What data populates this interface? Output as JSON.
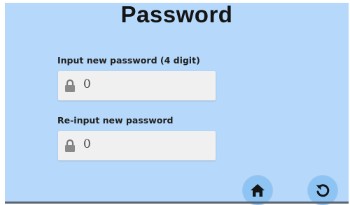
{
  "page": {
    "title": "Password"
  },
  "new_password": {
    "label": "Input new password  (4 digit)",
    "value": "0",
    "icon": "lock-icon"
  },
  "confirm_password": {
    "label": "Re-input new password",
    "value": "0",
    "icon": "lock-icon"
  },
  "nav": {
    "home_icon": "home-icon",
    "back_icon": "undo-icon"
  },
  "colors": {
    "background": "#b6d8fa",
    "field_background": "#f0f0f0",
    "button_background": "#8dc4f4",
    "icon_color": "#141414"
  }
}
